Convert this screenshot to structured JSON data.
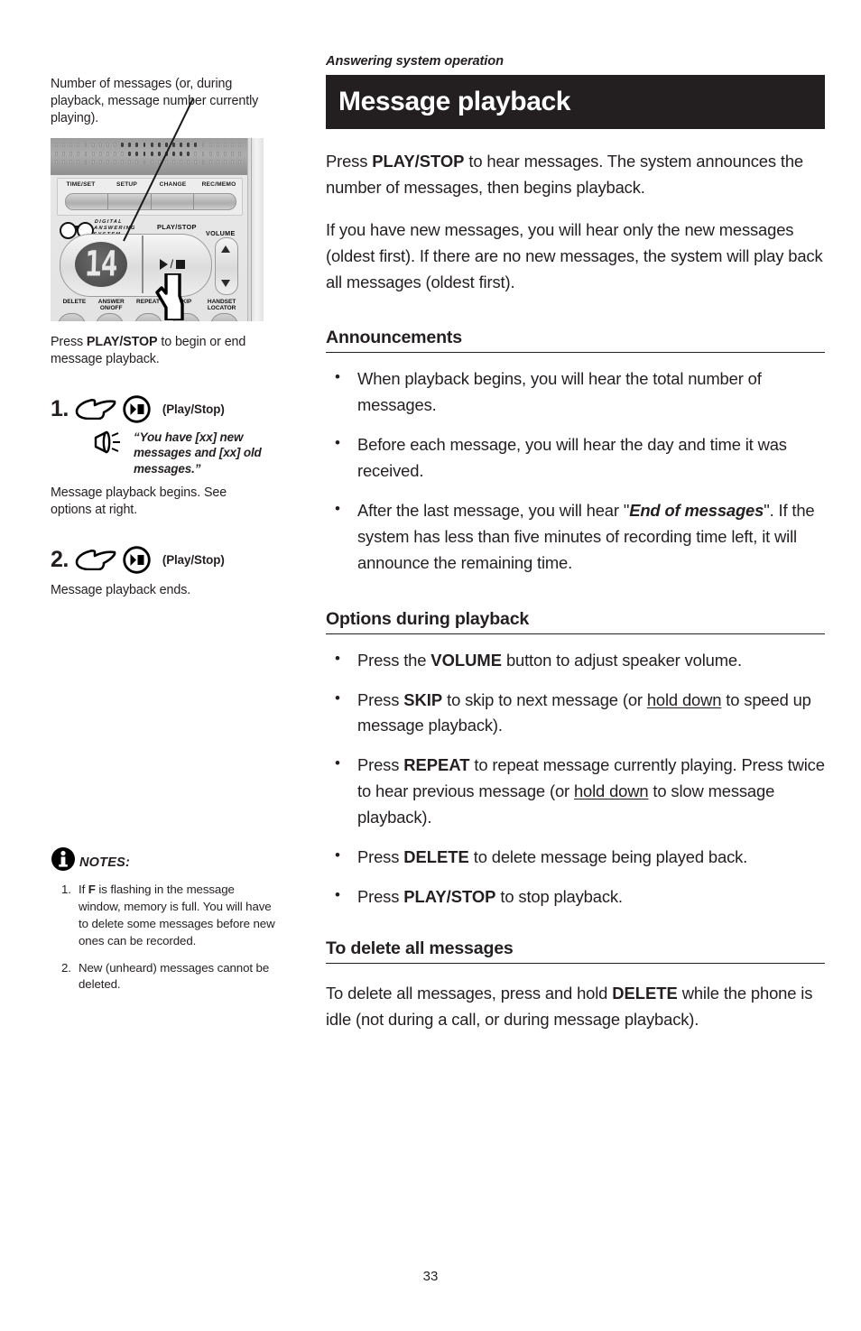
{
  "page": {
    "number": "33",
    "running_head": "Answering system operation",
    "title": "Message playback"
  },
  "left_column": {
    "top_caption": "Number of messages (or, during playback, message number currently playing).",
    "device": {
      "top_button_labels": [
        "TIME/SET",
        "SETUP",
        "CHANGE",
        "REC/MEMO"
      ],
      "logo_lines": [
        "DIGITAL",
        "ANSWERING",
        "SYSTEM"
      ],
      "play_stop_label": "PLAY/STOP",
      "volume_label": "VOLUME",
      "display_value": "14",
      "bottom_button_labels": [
        "DELETE",
        "ANSWER ON/OFF",
        "REPEAT",
        "SKIP",
        "HANDSET LOCATOR"
      ]
    },
    "under_caption": {
      "pre": "Press ",
      "bold": "PLAY/STOP",
      "post": " to begin or end message playback."
    },
    "steps": [
      {
        "number": "1.",
        "button_caption": "(Play/Stop)",
        "voice": "“You have [xx] new messages and [xx] old messages.”",
        "sub": "Message playback begins. See options at right."
      },
      {
        "number": "2.",
        "button_caption": "(Play/Stop)",
        "sub": "Message playback ends."
      }
    ],
    "notes": {
      "title": "NOTES:",
      "items": [
        {
          "n": "1.",
          "pre": "If ",
          "bold": "F",
          "post": " is flashing in the message window, memory is full. You will have to delete some messages before new ones can be recorded."
        },
        {
          "n": "2.",
          "pre": "",
          "bold": "",
          "post": "New (unheard) messages cannot be deleted."
        }
      ]
    }
  },
  "right_column": {
    "intro_p1": {
      "a": "Press ",
      "b": "PLAY/STOP",
      "c": " to hear messages. The system announces the number of messages, then begins playback."
    },
    "intro_p2": "If you have new messages, you will hear only the new messages (oldest first). If there are no new messages, the system will play back all messages (oldest first).",
    "sections": [
      {
        "heading": "Announcements",
        "bullets": [
          {
            "a": "When playback begins, you will hear the total number of messages.",
            "b": "",
            "c": "",
            "d": "",
            "e": ""
          },
          {
            "a": "Before each message, you will hear the day and time it was received.",
            "b": "",
            "c": "",
            "d": "",
            "e": ""
          },
          {
            "a": "After the last message, you will hear \"",
            "b": "End of messages",
            "c": "\". If the system has less than five minutes of recording time left, it will announce the remaining time.",
            "d": "",
            "e": ""
          }
        ]
      },
      {
        "heading": "Options during playback",
        "bullets": [
          {
            "a": "Press the ",
            "b": "VOLUME",
            "c": " button to adjust speaker volume.",
            "d": "",
            "e": ""
          },
          {
            "a": "Press ",
            "b": "SKIP",
            "c": " to skip to next message (or ",
            "d": "hold down",
            "e": " to speed up message playback)."
          },
          {
            "a": "Press ",
            "b": "REPEAT",
            "c": " to repeat message currently playing. Press twice to hear previous message (or ",
            "d": "hold down",
            "e": " to slow message playback)."
          },
          {
            "a": "Press ",
            "b": "DELETE",
            "c": " to delete message being played back.",
            "d": "",
            "e": ""
          },
          {
            "a": "Press ",
            "b": "PLAY/STOP",
            "c": " to stop playback.",
            "d": "",
            "e": ""
          }
        ]
      }
    ],
    "delete_all": {
      "heading": "To delete all messages",
      "a": "To delete all messages, press and hold ",
      "b": "DELETE",
      "c": " while the phone is idle (not during a call, or during message playback)."
    }
  }
}
